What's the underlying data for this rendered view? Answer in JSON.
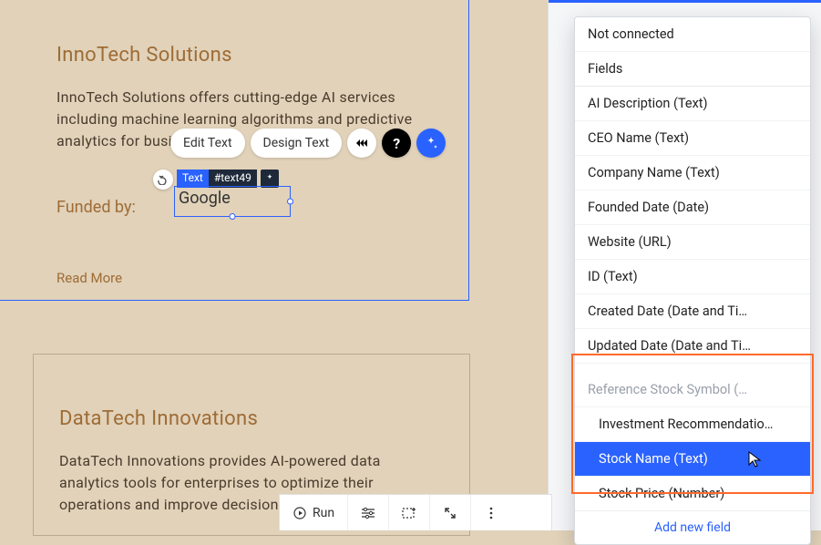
{
  "card1": {
    "title": "InnoTech Solutions",
    "desc": "InnoTech Solutions offers cutting-edge AI services including machine learning algorithms and predictive analytics for businesses.",
    "funded_label": "Funded by:",
    "funded_value": "Google",
    "read_more": "Read More"
  },
  "card2": {
    "title": "DataTech Innovations",
    "desc": "DataTech Innovations provides AI-powered data analytics tools for enterprises to optimize their operations and improve decision-making."
  },
  "sel": {
    "type_label": "Text",
    "element_id": "#text49"
  },
  "pills": {
    "edit": "Edit Text",
    "design": "Design Text"
  },
  "dropdown": {
    "not_connected": "Not connected",
    "section_fields": "Fields",
    "items": [
      "AI Description (Text)",
      "CEO Name (Text)",
      "Company Name (Text)",
      "Founded Date (Date)",
      "Website (URL)",
      "ID (Text)",
      "Created Date (Date and Ti…",
      "Updated Date (Date and Ti…"
    ],
    "ref_section": "Reference Stock Symbol (…",
    "ref_items": [
      "Investment Recommendatio…",
      "Stock Name (Text)",
      "Stock Price (Number)"
    ],
    "add": "Add new field"
  },
  "bottombar": {
    "run": "Run"
  }
}
